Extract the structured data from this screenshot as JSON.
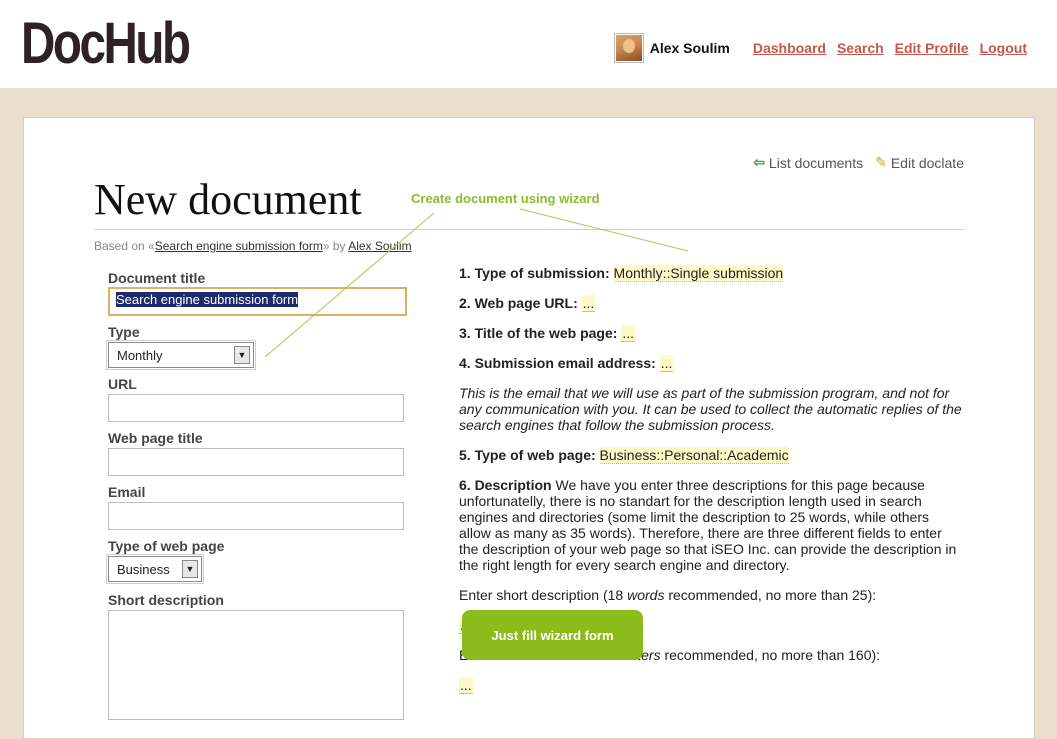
{
  "app": {
    "logo": "DocHub"
  },
  "usernav": {
    "username": "Alex Soulim",
    "links": [
      "Dashboard",
      "Search",
      "Edit Profile",
      "Logout"
    ]
  },
  "toplinks": {
    "list": "List documents",
    "edit": "Edit doclate"
  },
  "page": {
    "title": "New document",
    "based_on_prefix": "Based on",
    "based_on_doc": "Search engine submission form",
    "by_word": "by",
    "author": "Alex Soulim"
  },
  "form": {
    "doc_title_label": "Document title",
    "doc_title_value": "Search engine submission form",
    "type_label": "Type",
    "type_value": "Monthly",
    "url_label": "URL",
    "webtitle_label": "Web page title",
    "email_label": "Email",
    "webtype_label": "Type of web page",
    "webtype_value": "Business",
    "shortdesc_label": "Short description"
  },
  "content": {
    "q1_label": "1. Type of submission:",
    "q1_value": "Monthly::Single submission",
    "q2_label": "2. Web page URL:",
    "q3_label": "3. Title of the web page:",
    "q4_label": "4. Submission email address:",
    "placeholder": "...",
    "email_note": "This is the email that we will use as part of the submission program, and not for any communication with you. It can be used to collect the automatic replies of the search engines that follow the submission process.",
    "q5_label": "5. Type of web page:",
    "q5_value": "Business::Personal::Academic",
    "q6_label": "6. Description",
    "q6_text": "We have you enter three descriptions for this page because unfortunatelly, there is no standart for the description length used in search engines and directories (some limit the description to 25 words, while others allow as many as 35 words). Therefore, there are three different fields to enter the description of your web page so that iSEO Inc. can provide the description in the right length for every search engine and directory.",
    "short_prefix": "Enter short description (18",
    "short_em": "words",
    "short_suffix": "recommended, no more than 25):",
    "long_prefix": "E",
    "long_mid": "2",
    "long_em": "letters",
    "long_suffix": "recommended, no more than 160):"
  },
  "callouts": {
    "wizard_text": "Create document using wizard",
    "fill_button": "Just fill wizard form"
  },
  "colors": {
    "link": "#c8564a",
    "accent_green": "#8cbc1c",
    "highlight": "#fcfbc7"
  }
}
